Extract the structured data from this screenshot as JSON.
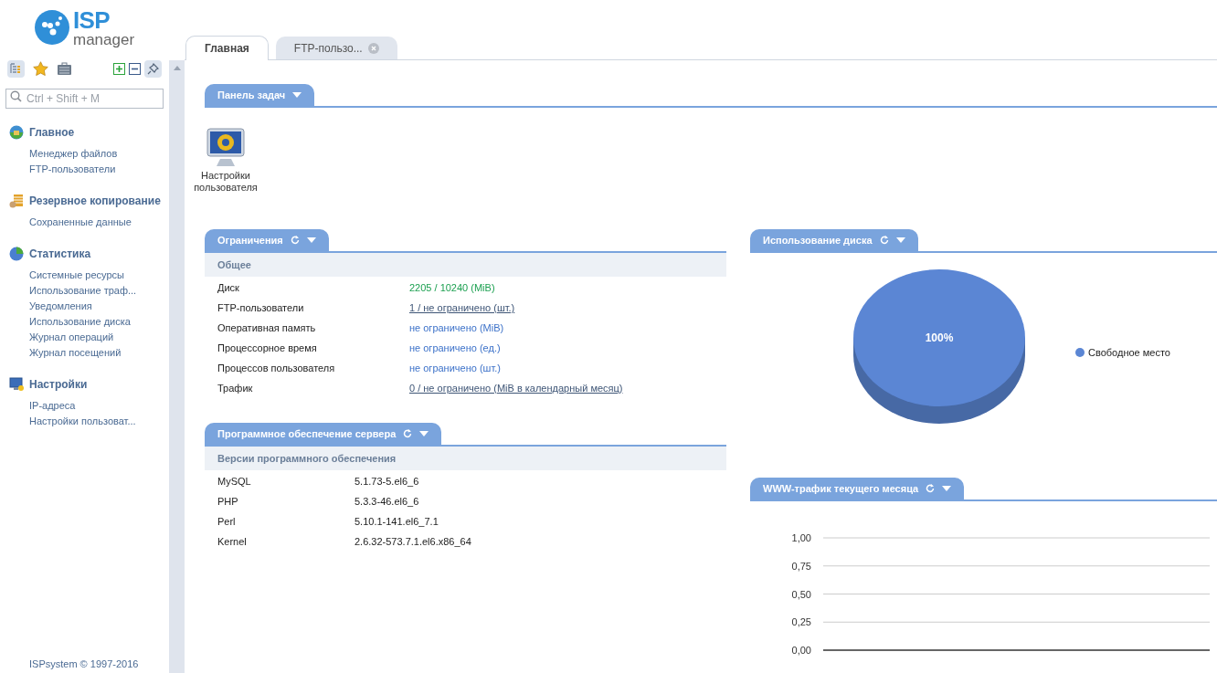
{
  "logo": {
    "brand": "ISP",
    "product": "manager"
  },
  "tabs": [
    {
      "label": "Главная",
      "selected": true,
      "closable": false
    },
    {
      "label": "FTP-пользо...",
      "selected": false,
      "closable": true
    }
  ],
  "sidebar": {
    "search": {
      "placeholder": "Ctrl + Shift + M"
    },
    "groups": [
      {
        "title": "Главное",
        "items": [
          "Менеджер файлов",
          "FTP-пользователи"
        ]
      },
      {
        "title": "Резервное копирование",
        "items": [
          "Сохраненные данные"
        ]
      },
      {
        "title": "Статистика",
        "items": [
          "Системные ресурсы",
          "Использование траф...",
          "Уведомления",
          "Использование диска",
          "Журнал операций",
          "Журнал посещений"
        ]
      },
      {
        "title": "Настройки",
        "items": [
          "IP-адреса",
          "Настройки пользоват..."
        ]
      }
    ],
    "footer": "ISPsystem © 1997-2016"
  },
  "taskbar": {
    "title": "Панель задач",
    "items": [
      {
        "label": "Настройки пользователя"
      }
    ]
  },
  "limits": {
    "title": "Ограничения",
    "section": "Общее",
    "rows": [
      {
        "name": "Диск",
        "value": "2205 / 10240 (MiB)",
        "kind": "ok"
      },
      {
        "name": "FTP-пользователи",
        "value": "1 / не ограничено (шт.)",
        "kind": "link"
      },
      {
        "name": "Оперативная память",
        "value": "не ограничено (MiB)",
        "kind": "plain"
      },
      {
        "name": "Процессорное время",
        "value": "не ограничено (ед.)",
        "kind": "plain"
      },
      {
        "name": "Процессов пользователя",
        "value": "не ограничено (шт.)",
        "kind": "plain"
      },
      {
        "name": "Трафик",
        "value": "0 / не ограничено (MiB в календарный месяц)",
        "kind": "link"
      }
    ]
  },
  "software": {
    "title": "Программное обеспечение сервера",
    "section": "Версии программного обеспечения",
    "rows": [
      {
        "name": "MySQL",
        "version": "5.1.73-5.el6_6"
      },
      {
        "name": "PHP",
        "version": "5.3.3-46.el6_6"
      },
      {
        "name": "Perl",
        "version": "5.10.1-141.el6_7.1"
      },
      {
        "name": "Kernel",
        "version": "2.6.32-573.7.1.el6.x86_64"
      }
    ]
  },
  "disk_usage": {
    "title": "Использование диска",
    "pie": {
      "legend": [
        "Свободное место"
      ],
      "slice_labels": [
        "100%"
      ]
    }
  },
  "www_traffic": {
    "title": "WWW-трафик текущего месяца",
    "empty_plot": {
      "axis_labels": [
        "1,00",
        "0,75",
        "0,50",
        "0,25",
        "0,00"
      ]
    }
  }
}
